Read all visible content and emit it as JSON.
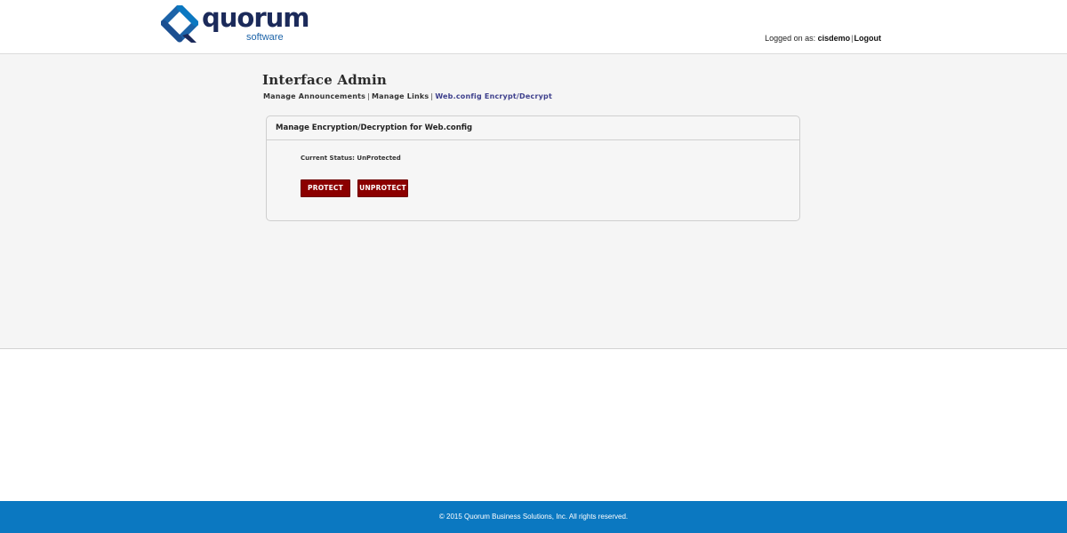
{
  "header": {
    "logo": {
      "word": "quorum",
      "sub": "software"
    },
    "user": {
      "prefix": "Logged on as: ",
      "username": "cisdemo",
      "separator": "|",
      "logout_label": "Logout"
    }
  },
  "page": {
    "title": "Interface Admin",
    "subnav": {
      "items": [
        {
          "label": "Manage Announcements",
          "active": false
        },
        {
          "label": "Manage Links",
          "active": false
        },
        {
          "label": "Web.config Encrypt/Decrypt",
          "active": true
        }
      ],
      "separator": "|"
    }
  },
  "panel": {
    "title": "Manage Encryption/Decryption for Web.config",
    "status_label": "Current Status: ",
    "status_value": "UnProtected",
    "buttons": {
      "protect": "PROTECT",
      "unprotect": "UNPROTECT"
    }
  },
  "footer": {
    "copyright": "© 2015 Quorum Business Solutions, Inc. All rights reserved."
  },
  "colors": {
    "brand_navy": "#1b2a5a",
    "brand_blue": "#1c63a8",
    "button_red": "#8b0000",
    "footer_blue": "#0b78c1",
    "active_link": "#3d3f8c"
  },
  "icons": {
    "logo_mark": "quorum-q-logo-icon"
  }
}
